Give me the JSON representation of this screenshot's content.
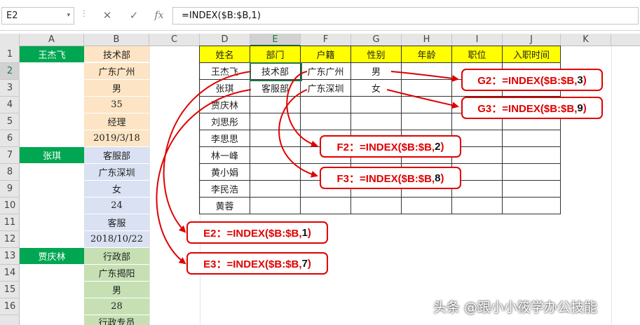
{
  "formula_bar": {
    "name_box": "E2",
    "formula": "=INDEX($B:$B,1)"
  },
  "icons": {
    "cancel": "✕",
    "confirm": "✓",
    "function": "fx",
    "dropdown": "▾",
    "dots": "⋮"
  },
  "columns": [
    "A",
    "B",
    "C",
    "D",
    "E",
    "F",
    "G",
    "H",
    "I",
    "J",
    "K"
  ],
  "rows": [
    "1",
    "2",
    "3",
    "4",
    "5",
    "6",
    "7",
    "8",
    "9",
    "10",
    "11",
    "12",
    "13",
    "14",
    "15",
    "16"
  ],
  "col_a": {
    "r1": "王杰飞",
    "r7": "张琪",
    "r13": "贾庆林"
  },
  "col_b": [
    "技术部",
    "广东广州",
    "男",
    "35",
    "经理",
    "2019/3/18",
    "客服部",
    "广东深圳",
    "女",
    "24",
    "客服",
    "2018/10/22",
    "行政部",
    "广东揭阳",
    "男",
    "28",
    "行政专员"
  ],
  "table": {
    "headers": [
      "姓名",
      "部门",
      "户籍",
      "性别",
      "年龄",
      "职位",
      "入职时间"
    ],
    "names": [
      "王杰飞",
      "张琪",
      "贾庆林",
      "刘思彤",
      "李思思",
      "林一峰",
      "黄小娟",
      "李民浩",
      "黄蓉"
    ],
    "row2": {
      "dept": "技术部",
      "hukou": "广东广州",
      "gender": "男"
    },
    "row3": {
      "dept": "客服部",
      "hukou": "广东深圳",
      "gender": "女"
    }
  },
  "callouts": {
    "g2": {
      "label": "G2：=INDEX($B:$B,",
      "num": "3",
      "close": ")"
    },
    "g3": {
      "label": "G3：=INDEX($B:$B,",
      "num": "9",
      "close": ")"
    },
    "f2": {
      "label": "F2：=INDEX($B:$B,",
      "num": "2",
      "close": ")"
    },
    "f3": {
      "label": "F3：=INDEX($B:$B,",
      "num": "8",
      "close": ")"
    },
    "e2": {
      "label": "E2：=INDEX($B:$B,",
      "num": "1",
      "close": ")"
    },
    "e3": {
      "label": "E3：=INDEX($B:$B,",
      "num": "7",
      "close": ")"
    }
  },
  "watermark": "头条 @跟小小筱学办公技能",
  "colors": {
    "green_header": "#00a651",
    "yellow_header": "#ffff00",
    "accent_red": "#e00000",
    "excel_green": "#217346"
  }
}
